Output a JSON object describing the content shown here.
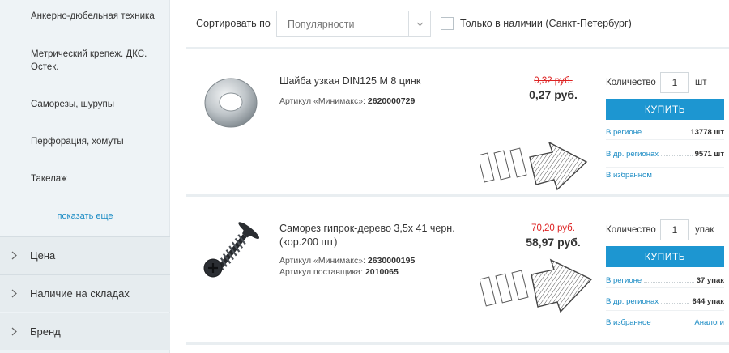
{
  "sidebar": {
    "categories": [
      {
        "label": "Анкерно-дюбельная техника"
      },
      {
        "label": "Метрический крепеж. ДКС. Остек."
      },
      {
        "label": "Саморезы, шурупы"
      },
      {
        "label": "Перфорация, хомуты"
      },
      {
        "label": "Такелаж"
      }
    ],
    "show_more": "показать еще",
    "filters": [
      {
        "label": "Цена"
      },
      {
        "label": "Наличие на складах"
      },
      {
        "label": "Бренд"
      }
    ]
  },
  "toolbar": {
    "sort_label": "Сортировать по",
    "sort_value": "Популярности",
    "stock_only_label": "Только в наличии (Санкт-Петербург)",
    "stock_only_checked": false
  },
  "products": [
    {
      "name": "Шайба узкая DIN125 М 8 цинк",
      "article_label": "Артикул «Минимакс»:",
      "article": "2620000729",
      "old_price": "0,32 руб.",
      "new_price": "0,27 руб.",
      "qty_label": "Количество",
      "qty": "1",
      "unit": "шт",
      "buy_label": "КУПИТЬ",
      "stock": [
        {
          "label": "В регионе",
          "value": "13778 шт"
        },
        {
          "label": "В др. регионах",
          "value": "9571 шт"
        }
      ],
      "favorite_label": "В избранном",
      "analogs_label": ""
    },
    {
      "name": "Саморез гипрок-дерево 3,5х 41 черн. (кор.200 шт)",
      "article_label": "Артикул «Минимакс»:",
      "article": "2630000195",
      "supplier_article_label": "Артикул поставщика:",
      "supplier_article": "2010065",
      "old_price": "70,20 руб.",
      "new_price": "58,97 руб.",
      "qty_label": "Количество",
      "qty": "1",
      "unit": "упак",
      "buy_label": "КУПИТЬ",
      "stock": [
        {
          "label": "В регионе",
          "value": "37 упак"
        },
        {
          "label": "В др. регионах",
          "value": "644 упак"
        }
      ],
      "favorite_label": "В избранное",
      "analogs_label": "Аналоги"
    }
  ],
  "colors": {
    "accent": "#1d96d1",
    "link": "#1a8bc4",
    "old_price": "#dd2222",
    "sidebar_bg": "#eef3f6"
  }
}
